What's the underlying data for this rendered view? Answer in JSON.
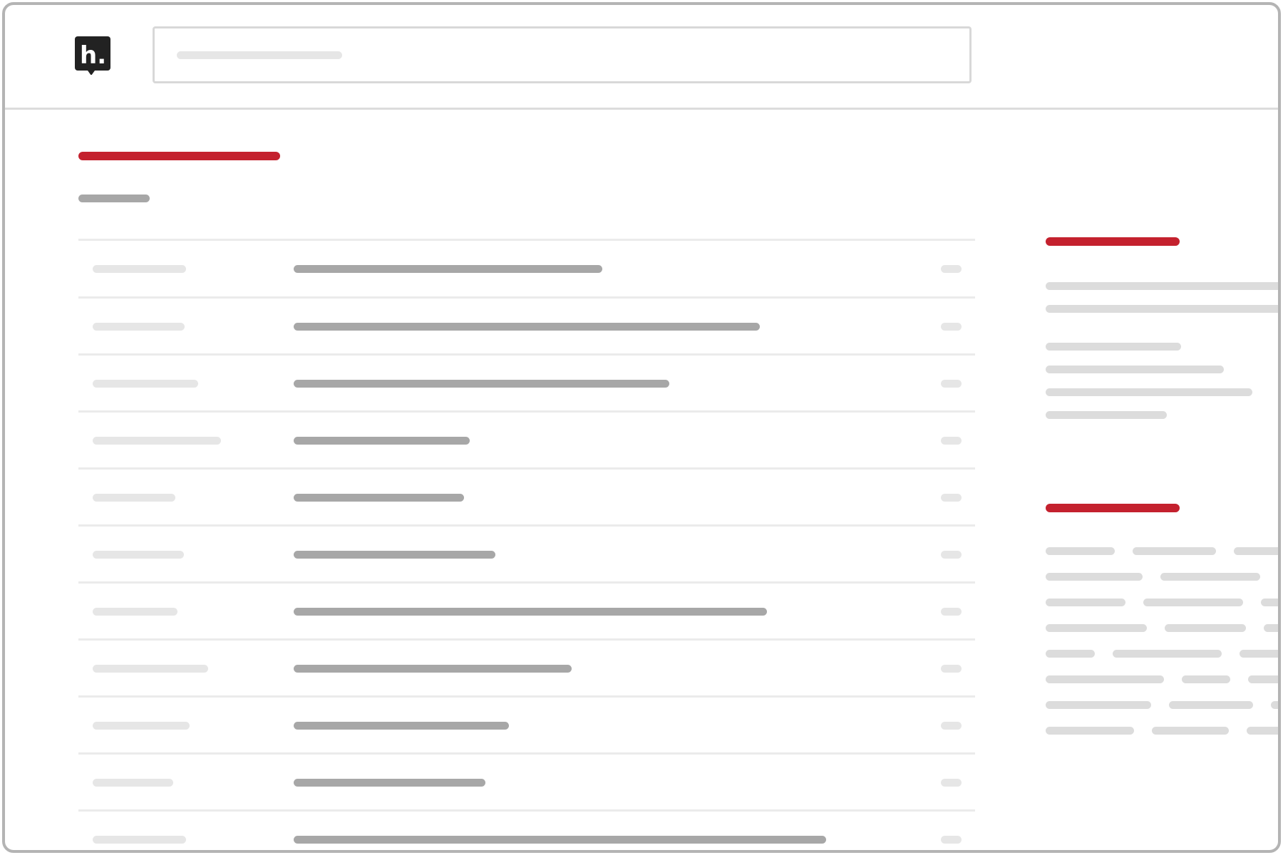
{
  "header": {
    "logo_letter": "h.",
    "search_placeholder": ""
  },
  "main": {
    "title": "",
    "subtitle": "",
    "rows": [
      {
        "label": "",
        "value": "",
        "count": ""
      },
      {
        "label": "",
        "value": "",
        "count": ""
      },
      {
        "label": "",
        "value": "",
        "count": ""
      },
      {
        "label": "",
        "value": "",
        "count": ""
      },
      {
        "label": "",
        "value": "",
        "count": ""
      },
      {
        "label": "",
        "value": "",
        "count": ""
      },
      {
        "label": "",
        "value": "",
        "count": ""
      },
      {
        "label": "",
        "value": "",
        "count": ""
      },
      {
        "label": "",
        "value": "",
        "count": ""
      },
      {
        "label": "",
        "value": "",
        "count": ""
      },
      {
        "label": "",
        "value": "",
        "count": ""
      }
    ]
  },
  "sidebar": {
    "section_one": {
      "heading": "",
      "lines": [
        "",
        "",
        "",
        "",
        "",
        ""
      ]
    },
    "section_two": {
      "heading": "",
      "tags": []
    }
  },
  "colors": {
    "accent": "#c4212e",
    "frame_border": "#b4b4b4",
    "skeleton_dark": "#a7a7a7",
    "skeleton_light": "#e6e6e6",
    "logo": "#222222"
  }
}
